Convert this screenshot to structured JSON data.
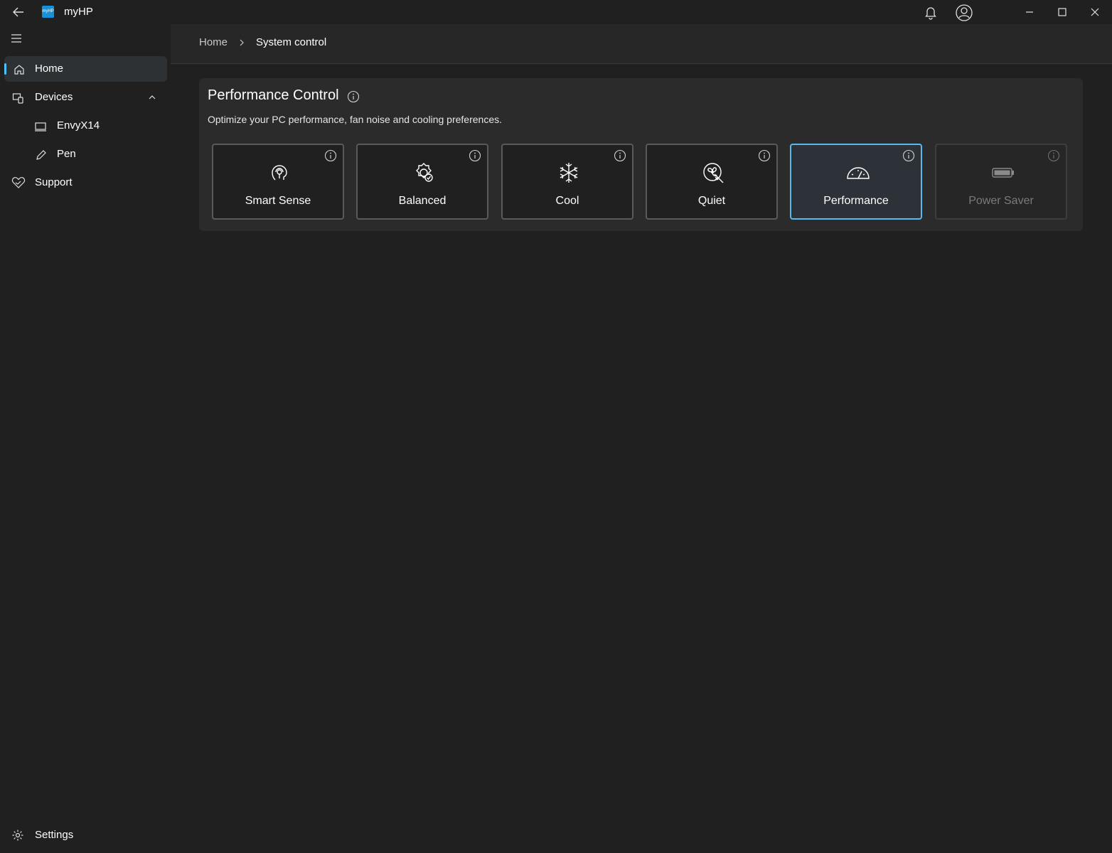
{
  "window": {
    "title": "myHP",
    "logo_text": "myHP"
  },
  "sidebar": {
    "items": [
      {
        "label": "Home",
        "icon": "home-icon",
        "active": true
      },
      {
        "label": "Devices",
        "icon": "devices-icon",
        "expanded": true
      },
      {
        "label": "EnvyX14",
        "icon": "laptop-icon"
      },
      {
        "label": "Pen",
        "icon": "pen-icon"
      },
      {
        "label": "Support",
        "icon": "support-icon"
      }
    ],
    "settings_label": "Settings"
  },
  "breadcrumb": {
    "home": "Home",
    "current": "System control"
  },
  "performance": {
    "title": "Performance Control",
    "description": "Optimize your PC performance, fan noise and cooling preferences.",
    "modes": [
      {
        "label": "Smart Sense",
        "icon": "smart-sense-icon",
        "state": "normal"
      },
      {
        "label": "Balanced",
        "icon": "balanced-gear-icon",
        "state": "normal"
      },
      {
        "label": "Cool",
        "icon": "snowflake-icon",
        "state": "normal"
      },
      {
        "label": "Quiet",
        "icon": "quiet-fan-icon",
        "state": "normal"
      },
      {
        "label": "Performance",
        "icon": "speedometer-icon",
        "state": "selected"
      },
      {
        "label": "Power Saver",
        "icon": "battery-icon",
        "state": "disabled"
      }
    ]
  },
  "colors": {
    "accent": "#4cc2ff",
    "selected_border": "#5ab8ef",
    "background": "#202020",
    "panel": "#2b2b2b"
  }
}
